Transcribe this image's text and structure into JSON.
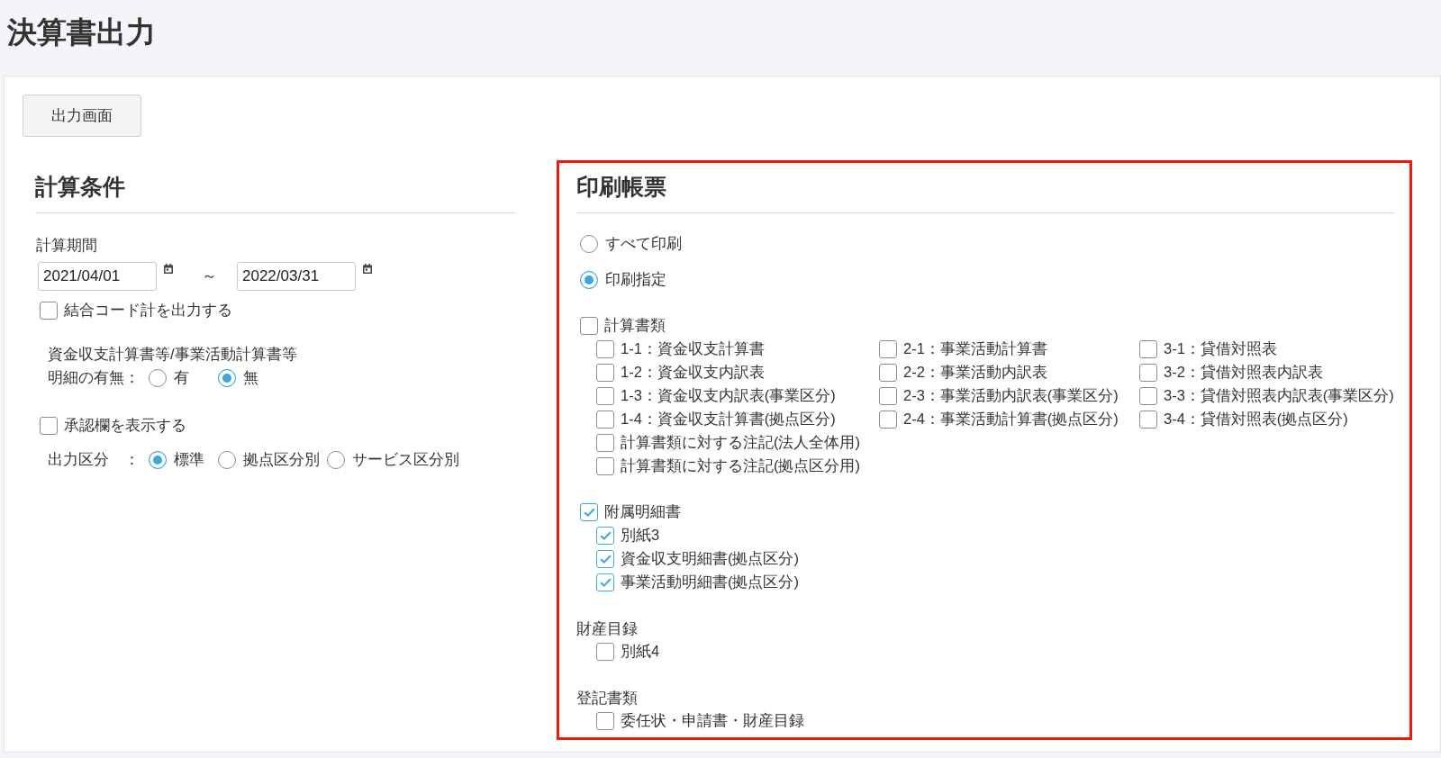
{
  "page": {
    "title": "決算書出力"
  },
  "toolbar": {
    "buttons": [
      {
        "label": "出力画面"
      }
    ]
  },
  "calc_conditions": {
    "title": "計算条件",
    "items": [
      {
        "kind": "date_range",
        "label": "計算期間",
        "from": "2021/04/01",
        "separator": "～",
        "to": "2022/03/31"
      },
      {
        "kind": "checkbox",
        "label": "結合コード計を出力する",
        "checked": false
      },
      {
        "kind": "note",
        "text": "資金収支計算書等/事業活動計算書等"
      },
      {
        "kind": "radio_group",
        "label": "明細の有無：",
        "options": [
          {
            "label": "有",
            "selected": false
          },
          {
            "label": "無",
            "selected": true
          }
        ]
      },
      {
        "kind": "checkbox",
        "label": "承認欄を表示する",
        "checked": false
      },
      {
        "kind": "radio_group",
        "label": "出力区分　：",
        "options": [
          {
            "label": "標準",
            "selected": true
          },
          {
            "label": "拠点区分別",
            "selected": false
          },
          {
            "label": "サービス区分別",
            "selected": false
          }
        ]
      }
    ]
  },
  "print_forms": {
    "title": "印刷帳票",
    "highlighted": true,
    "modes": [
      {
        "label": "すべて印刷",
        "selected": false
      },
      {
        "label": "印刷指定",
        "selected": true
      }
    ],
    "groups": [
      {
        "kind": "checkbox",
        "label": "計算書類",
        "checked": false,
        "columns": [
          {
            "items": [
              {
                "label": "1-1：資金収支計算書",
                "checked": false
              },
              {
                "label": "1-2：資金収支内訳表",
                "checked": false
              },
              {
                "label": "1-3：資金収支内訳表(事業区分)",
                "checked": false
              },
              {
                "label": "1-4：資金収支計算書(拠点区分)",
                "checked": false
              },
              {
                "label": "計算書類に対する注記(法人全体用)",
                "checked": false
              },
              {
                "label": "計算書類に対する注記(拠点区分用)",
                "checked": false
              }
            ]
          },
          {
            "items": [
              {
                "label": "2-1：事業活動計算書",
                "checked": false
              },
              {
                "label": "2-2：事業活動内訳表",
                "checked": false
              },
              {
                "label": "2-3：事業活動内訳表(事業区分)",
                "checked": false
              },
              {
                "label": "2-4：事業活動計算書(拠点区分)",
                "checked": false
              }
            ]
          },
          {
            "items": [
              {
                "label": "3-1：貸借対照表",
                "checked": false
              },
              {
                "label": "3-2：貸借対照表内訳表",
                "checked": false
              },
              {
                "label": "3-3：貸借対照表内訳表(事業区分)",
                "checked": false
              },
              {
                "label": "3-4：貸借対照表(拠点区分)",
                "checked": false
              }
            ]
          }
        ]
      },
      {
        "kind": "checkbox",
        "label": "附属明細書",
        "checked": true,
        "columns": [
          {
            "items": [
              {
                "label": "別紙3",
                "checked": true
              },
              {
                "label": "資金収支明細書(拠点区分)",
                "checked": true
              },
              {
                "label": "事業活動明細書(拠点区分)",
                "checked": true
              }
            ]
          }
        ]
      },
      {
        "kind": "heading",
        "label": "財産目録",
        "columns": [
          {
            "items": [
              {
                "label": "別紙4",
                "checked": false
              }
            ]
          }
        ]
      },
      {
        "kind": "heading",
        "label": "登記書類",
        "columns": [
          {
            "items": [
              {
                "label": "委任状・申請書・財産目録",
                "checked": false
              }
            ]
          }
        ]
      }
    ]
  }
}
